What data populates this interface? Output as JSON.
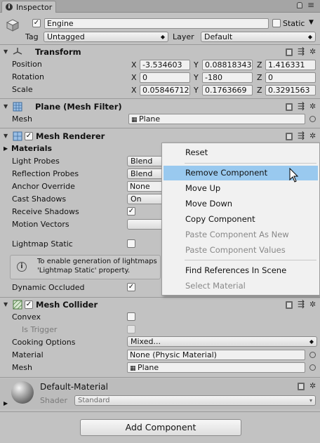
{
  "window": {
    "tab_title": "Inspector"
  },
  "gameobject": {
    "name": "Engine",
    "static_label": "Static",
    "tag_label": "Tag",
    "tag_value": "Untagged",
    "layer_label": "Layer",
    "layer_value": "Default"
  },
  "transform": {
    "title": "Transform",
    "position_label": "Position",
    "rotation_label": "Rotation",
    "scale_label": "Scale",
    "position": {
      "x": "-3.534603",
      "y": "0.08818343",
      "z": "1.416331"
    },
    "rotation": {
      "x": "0",
      "y": "-180",
      "z": "0"
    },
    "scale": {
      "x": "0.05846712",
      "y": "0.1763669",
      "z": "0.3291563"
    },
    "axis_x": "X",
    "axis_y": "Y",
    "axis_z": "Z"
  },
  "mesh_filter": {
    "title": "Plane (Mesh Filter)",
    "mesh_label": "Mesh",
    "mesh_value": "Plane"
  },
  "mesh_renderer": {
    "title": "Mesh Renderer",
    "materials_label": "Materials",
    "light_probes_label": "Light Probes",
    "light_probes_value": "Blend",
    "reflection_probes_label": "Reflection Probes",
    "reflection_probes_value": "Blend",
    "anchor_override_label": "Anchor Override",
    "anchor_override_value": "None",
    "cast_shadows_label": "Cast Shadows",
    "cast_shadows_value": "On",
    "receive_shadows_label": "Receive Shadows",
    "receive_shadows_checked": true,
    "motion_vectors_label": "Motion Vectors",
    "lightmap_static_label": "Lightmap Static",
    "lightmap_static_checked": false,
    "info_line1": "To enable generation of lightmaps",
    "info_line2": "'Lightmap Static' property.",
    "dynamic_occluded_label": "Dynamic Occluded",
    "dynamic_occluded_checked": true
  },
  "context_menu": {
    "items": [
      {
        "label": "Reset",
        "enabled": true,
        "highlighted": false
      },
      {
        "label": "Remove Component",
        "enabled": true,
        "highlighted": true
      },
      {
        "label": "Move Up",
        "enabled": true,
        "highlighted": false
      },
      {
        "label": "Move Down",
        "enabled": true,
        "highlighted": false
      },
      {
        "label": "Copy Component",
        "enabled": true,
        "highlighted": false
      },
      {
        "label": "Paste Component As New",
        "enabled": false,
        "highlighted": false
      },
      {
        "label": "Paste Component Values",
        "enabled": false,
        "highlighted": false
      },
      {
        "label": "Find References In Scene",
        "enabled": true,
        "highlighted": false
      },
      {
        "label": "Select Material",
        "enabled": false,
        "highlighted": false
      }
    ]
  },
  "mesh_collider": {
    "title": "Mesh Collider",
    "convex_label": "Convex",
    "is_trigger_label": "Is Trigger",
    "cooking_options_label": "Cooking Options",
    "cooking_options_value": "Mixed...",
    "material_label": "Material",
    "material_value": "None (Physic Material)",
    "mesh_label": "Mesh",
    "mesh_value": "Plane"
  },
  "material_asset": {
    "name": "Default-Material",
    "shader_label": "Shader",
    "shader_value": "Standard"
  },
  "add_component_label": "Add Component",
  "colors": {
    "panel_bg": "#c2c2c2",
    "menu_highlight": "#99c9ef"
  }
}
